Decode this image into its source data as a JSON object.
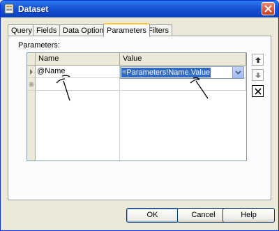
{
  "window": {
    "title": "Dataset",
    "title_icon": "dataset-window-icon",
    "close_icon": "close-icon"
  },
  "tabs": [
    {
      "label": "Query",
      "active": false
    },
    {
      "label": "Fields",
      "active": false
    },
    {
      "label": "Data Options",
      "active": false
    },
    {
      "label": "Parameters",
      "active": true
    },
    {
      "label": "Filters",
      "active": false
    }
  ],
  "parameters": {
    "label": "Parameters:",
    "columns": [
      "Name",
      "Value"
    ],
    "rows": [
      {
        "indicator": "current-row-arrow",
        "name": "@Name",
        "value": "=Parameters!Name.Value"
      },
      {
        "indicator": "new-row-star",
        "name": "",
        "value": ""
      }
    ],
    "side_buttons": [
      "move-up-icon",
      "move-down-icon",
      "delete-icon"
    ]
  },
  "buttons": {
    "ok": "OK",
    "cancel": "Cancel",
    "help": "Help"
  },
  "colors": {
    "title_bar": "#0f46c9",
    "selection": "#316ac5",
    "active_tab_accent": "#ffc83c"
  }
}
